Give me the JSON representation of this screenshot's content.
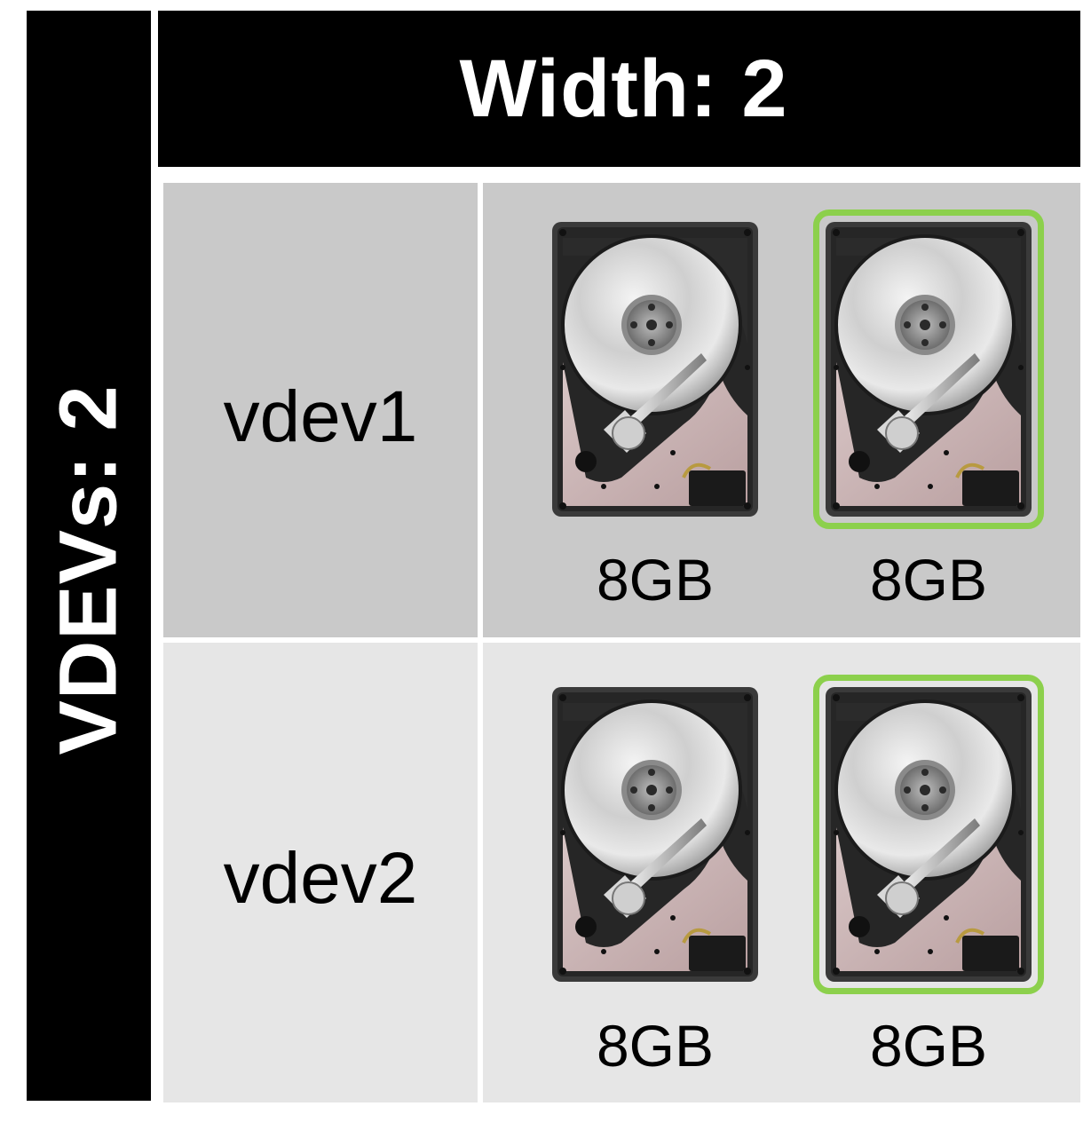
{
  "header": {
    "title": "Width: 2"
  },
  "side": {
    "title": "VDEVs: 2"
  },
  "colors": {
    "accent_selected": "#8cd04c",
    "row1_bg": "#c9c9c9",
    "row2_bg": "#e6e6e6",
    "bar_bg": "#000000"
  },
  "vdevs": [
    {
      "label": "vdev1",
      "drives": [
        {
          "capacity": "8GB",
          "icon": "hard-drive-icon",
          "highlighted": false
        },
        {
          "capacity": "8GB",
          "icon": "hard-drive-icon",
          "highlighted": true
        }
      ]
    },
    {
      "label": "vdev2",
      "drives": [
        {
          "capacity": "8GB",
          "icon": "hard-drive-icon",
          "highlighted": false
        },
        {
          "capacity": "8GB",
          "icon": "hard-drive-icon",
          "highlighted": true
        }
      ]
    }
  ]
}
